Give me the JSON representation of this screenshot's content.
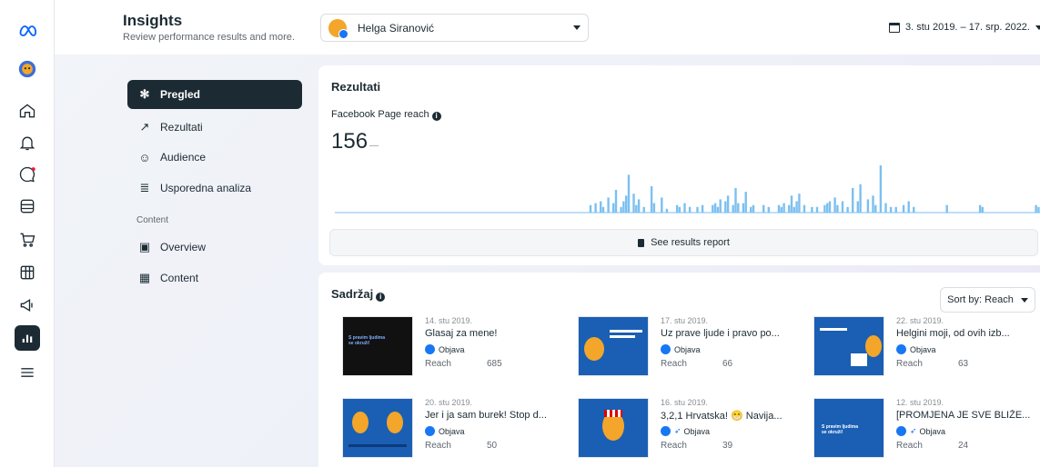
{
  "header": {
    "title": "Insights",
    "subtitle": "Review performance results and more.",
    "account_name": "Helga Siranović",
    "date_range": "3. stu 2019. – 17. srp. 2022."
  },
  "rail_icons": [
    "meta-logo-icon",
    "profile-avatar-icon",
    "home-icon",
    "notifications-icon",
    "messages-icon",
    "pages-icon",
    "shop-icon",
    "planner-icon",
    "ads-icon",
    "insights-icon",
    "menu-icon"
  ],
  "nav": {
    "items": [
      {
        "label": "Pregled",
        "icon": "overview-icon",
        "active": true
      },
      {
        "label": "Rezultati",
        "icon": "results-icon"
      },
      {
        "label": "Audience",
        "icon": "audience-icon"
      },
      {
        "label": "Usporedna analiza",
        "icon": "benchmark-icon"
      }
    ],
    "section_label": "Content",
    "content_items": [
      {
        "label": "Overview",
        "icon": "content-overview-icon"
      },
      {
        "label": "Content",
        "icon": "content-table-icon"
      }
    ]
  },
  "results": {
    "title": "Rezultati",
    "metric_label": "Facebook Page reach",
    "metric_value": "156",
    "report_button": "See results report"
  },
  "content": {
    "title": "Sadržaj",
    "sort_label": "Sort by: Reach",
    "reach_label": "Reach",
    "posts": [
      {
        "date": "14. stu 2019.",
        "title": "Glasaj za mene!",
        "type": "Objava",
        "reach": "685",
        "extra_icon": false
      },
      {
        "date": "17. stu 2019.",
        "title": "Uz prave ljude i pravo po...",
        "type": "Objava",
        "reach": "66",
        "extra_icon": false
      },
      {
        "date": "22. stu 2019.",
        "title": "Helgini moji, od ovih izb...",
        "type": "Objava",
        "reach": "63",
        "extra_icon": false
      },
      {
        "date": "20. stu 2019.",
        "title": "Jer i ja sam burek! Stop d...",
        "type": "Objava",
        "reach": "50",
        "extra_icon": false
      },
      {
        "date": "16. stu 2019.",
        "title": "3,2,1 Hrvatska! 😁 Navija...",
        "type": "Objava",
        "reach": "39",
        "extra_icon": true
      },
      {
        "date": "12. stu 2019.",
        "title": "[PROMJENA JE SVE BLIŽE...",
        "type": "Objava",
        "reach": "24",
        "extra_icon": true
      }
    ]
  },
  "chart_data": {
    "type": "bar",
    "title": "Facebook Page reach",
    "x_range": [
      "3. stu 2019.",
      "17. srp. 2022."
    ],
    "values": [
      0,
      0,
      0,
      0,
      0,
      0,
      0,
      0,
      0,
      0,
      0,
      0,
      0,
      0,
      0,
      0,
      0,
      0,
      0,
      0,
      0,
      0,
      0,
      0,
      0,
      0,
      0,
      0,
      0,
      0,
      0,
      0,
      0,
      0,
      0,
      0,
      0,
      0,
      0,
      0,
      0,
      0,
      0,
      0,
      0,
      0,
      0,
      0,
      0,
      0,
      0,
      0,
      0,
      0,
      0,
      0,
      0,
      0,
      0,
      0,
      0,
      0,
      0,
      0,
      0,
      0,
      0,
      0,
      0,
      0,
      0,
      0,
      0,
      0,
      0,
      0,
      0,
      0,
      0,
      0,
      0,
      0,
      0,
      0,
      0,
      0,
      0,
      0,
      0,
      0,
      0,
      0,
      0,
      0,
      0,
      0,
      0,
      0,
      0,
      0,
      4,
      0,
      5,
      0,
      6,
      3,
      0,
      8,
      0,
      5,
      12,
      0,
      3,
      6,
      9,
      20,
      0,
      10,
      4,
      7,
      0,
      3,
      0,
      0,
      14,
      5,
      0,
      0,
      8,
      0,
      2,
      0,
      0,
      0,
      4,
      3,
      0,
      5,
      0,
      3,
      0,
      0,
      3,
      0,
      4,
      0,
      0,
      0,
      4,
      5,
      3,
      7,
      0,
      6,
      9,
      0,
      4,
      13,
      5,
      0,
      5,
      11,
      0,
      3,
      4,
      0,
      0,
      0,
      4,
      0,
      3,
      0,
      0,
      0,
      4,
      3,
      5,
      0,
      4,
      9,
      3,
      6,
      10,
      0,
      4,
      0,
      0,
      3,
      0,
      3,
      0,
      0,
      4,
      5,
      6,
      0,
      8,
      4,
      0,
      6,
      0,
      3,
      0,
      13,
      0,
      6,
      15,
      0,
      0,
      7,
      0,
      9,
      4,
      0,
      25,
      0,
      5,
      0,
      3,
      0,
      3,
      0,
      0,
      4,
      0,
      6,
      0,
      3,
      0,
      0,
      0,
      0,
      0,
      0,
      0,
      0,
      0,
      0,
      0,
      0,
      4,
      0,
      0,
      0,
      0,
      0,
      0,
      0,
      0,
      0,
      0,
      0,
      0,
      4,
      3,
      0,
      0,
      0,
      0,
      0,
      0,
      0,
      0,
      0,
      0,
      0,
      0,
      0,
      0,
      0,
      0,
      0,
      0,
      0,
      0,
      4,
      3
    ]
  }
}
